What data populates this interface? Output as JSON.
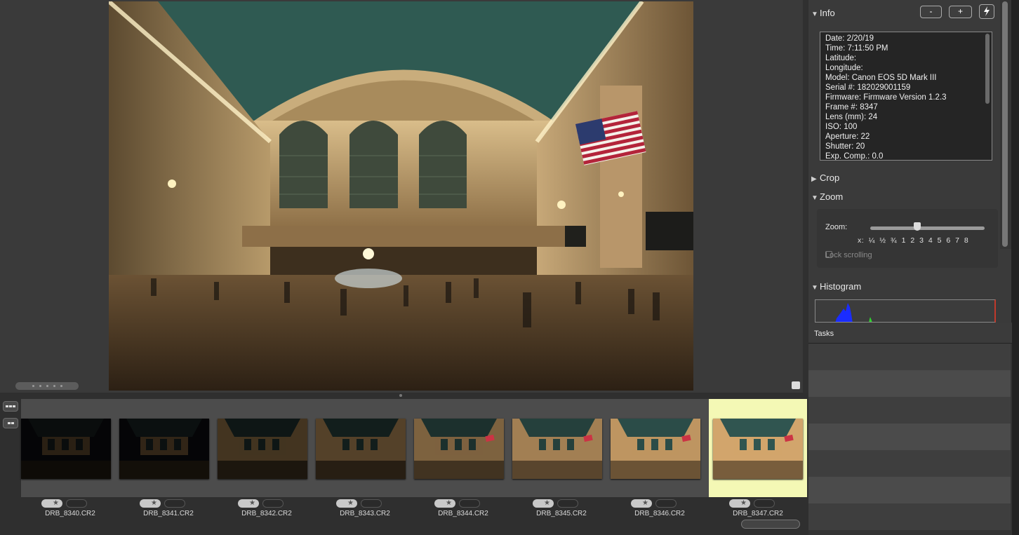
{
  "viewer": {
    "photo_alt": "Grand Central Terminal interior"
  },
  "filmstrip": {
    "thumbnails": [
      {
        "filename": "DRB_8340.CR2",
        "rating_icon": "star",
        "selected": false,
        "brightness": 0.04
      },
      {
        "filename": "DRB_8341.CR2",
        "rating_icon": "star",
        "selected": false,
        "brightness": 0.08
      },
      {
        "filename": "DRB_8342.CR2",
        "rating_icon": "star",
        "selected": false,
        "brightness": 0.16
      },
      {
        "filename": "DRB_8343.CR2",
        "rating_icon": "star",
        "selected": false,
        "brightness": 0.26
      },
      {
        "filename": "DRB_8344.CR2",
        "rating_icon": "star",
        "selected": false,
        "brightness": 0.5
      },
      {
        "filename": "DRB_8345.CR2",
        "rating_icon": "star",
        "selected": false,
        "brightness": 0.72
      },
      {
        "filename": "DRB_8346.CR2",
        "rating_icon": "star",
        "selected": false,
        "brightness": 0.88
      },
      {
        "filename": "DRB_8347.CR2",
        "rating_icon": "star",
        "selected": true,
        "brightness": 1.0
      }
    ]
  },
  "panel": {
    "info": {
      "title": "Info",
      "buttons": {
        "minus": "-",
        "plus": "+",
        "bolt_icon": "lightning-icon"
      },
      "lines": [
        "Date: 2/20/19",
        "Time: 7:11:50 PM",
        "Latitude:",
        "Longitude:",
        "Model: Canon EOS 5D Mark III",
        "Serial #: 182029001159",
        "Firmware: Firmware Version 1.2.3",
        "Frame #: 8347",
        "Lens (mm): 24",
        "ISO: 100",
        "Aperture: 22",
        "Shutter: 20",
        "Exp. Comp.: 0.0"
      ]
    },
    "crop": {
      "title": "Crop"
    },
    "zoom": {
      "title": "Zoom",
      "label": "Zoom:",
      "ticks": "x:  ¼  ½  ¾  1  2  3  4  5  6  7  8",
      "lock_label": "Lock scrolling",
      "level": 0.41
    },
    "histogram": {
      "title": "Histogram"
    }
  },
  "tasks": {
    "title": "Tasks",
    "rows": 7
  },
  "colors": {
    "selected_thumb_bg": "#f4f8b5",
    "panel_bg": "#3a3a3a",
    "hist_blue": "#1a2cff",
    "hist_green": "#2fd12f"
  }
}
